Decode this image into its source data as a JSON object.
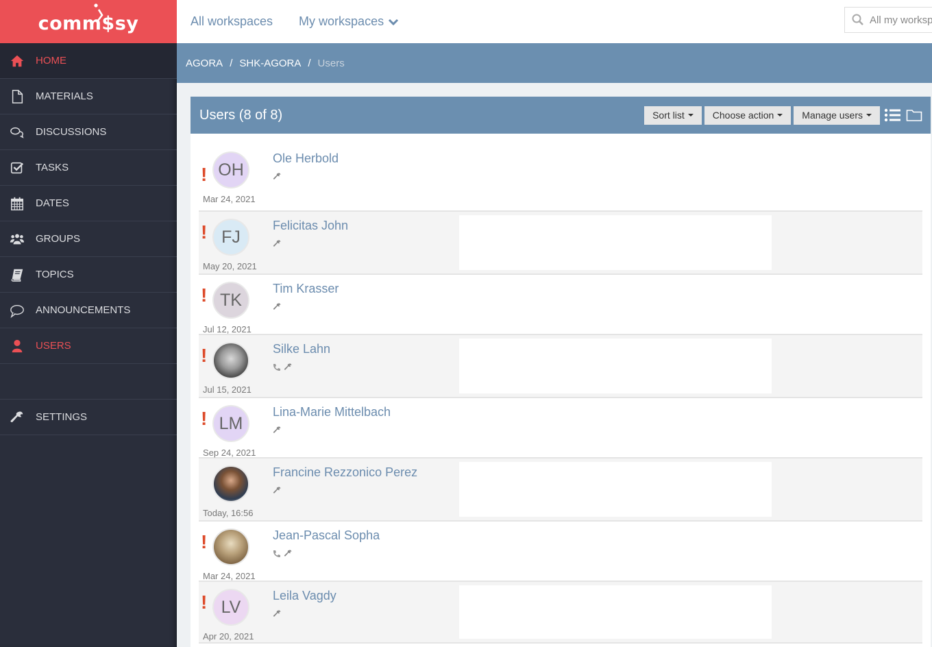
{
  "brand": {
    "logo_text": "comm$sy",
    "accent": "#eb5055"
  },
  "sidebar": {
    "items": [
      {
        "label": "HOME",
        "icon": "home-icon",
        "active_style": "accent"
      },
      {
        "label": "MATERIALS",
        "icon": "file-icon"
      },
      {
        "label": "DISCUSSIONS",
        "icon": "comments-icon"
      },
      {
        "label": "TASKS",
        "icon": "checkbox-icon"
      },
      {
        "label": "DATES",
        "icon": "calendar-icon"
      },
      {
        "label": "GROUPS",
        "icon": "users-group-icon"
      },
      {
        "label": "TOPICS",
        "icon": "book-icon"
      },
      {
        "label": "ANNOUNCEMENTS",
        "icon": "speech-bubble-icon"
      },
      {
        "label": "USERS",
        "icon": "user-icon",
        "active": true
      },
      {
        "label": "SETTINGS",
        "icon": "wrench-icon"
      }
    ]
  },
  "topbar": {
    "all_workspaces": "All workspaces",
    "my_workspaces": "My workspaces",
    "search_placeholder": "All my workspaces"
  },
  "breadcrumb": [
    "AGORA",
    "SHK-AGORA",
    "Users"
  ],
  "panel": {
    "title": "Users (8 of 8)",
    "buttons": {
      "sort": "Sort list",
      "action": "Choose action",
      "manage": "Manage users"
    }
  },
  "users": [
    {
      "name": "Ole Herbold",
      "initials": "OH",
      "date": "Mar 24, 2021",
      "alert": true,
      "phone": false,
      "avatar_color": "#e2d5f5",
      "photo": null
    },
    {
      "name": "Felicitas John",
      "initials": "FJ",
      "date": "May 20, 2021",
      "alert": true,
      "phone": false,
      "avatar_color": "#d9eaf5",
      "photo": null
    },
    {
      "name": "Tim Krasser",
      "initials": "TK",
      "date": "Jul 12, 2021",
      "alert": true,
      "phone": false,
      "avatar_color": "#dcd5dd",
      "photo": null
    },
    {
      "name": "Silke Lahn",
      "initials": "",
      "date": "Jul 15, 2021",
      "alert": true,
      "phone": true,
      "avatar_color": null,
      "photo": "silke"
    },
    {
      "name": "Lina-Marie Mittelbach",
      "initials": "LM",
      "date": "Sep 24, 2021",
      "alert": true,
      "phone": false,
      "avatar_color": "#e2d5f5",
      "photo": null
    },
    {
      "name": "Francine Rezzonico Perez",
      "initials": "",
      "date": "Today, 16:56",
      "alert": false,
      "phone": false,
      "avatar_color": null,
      "photo": "francine"
    },
    {
      "name": "Jean-Pascal Sopha",
      "initials": "",
      "date": "Mar 24, 2021",
      "alert": true,
      "phone": true,
      "avatar_color": null,
      "photo": "jp"
    },
    {
      "name": "Leila Vagdy",
      "initials": "LV",
      "date": "Apr 20, 2021",
      "alert": true,
      "phone": false,
      "avatar_color": "#ecd8f2",
      "photo": null
    }
  ]
}
